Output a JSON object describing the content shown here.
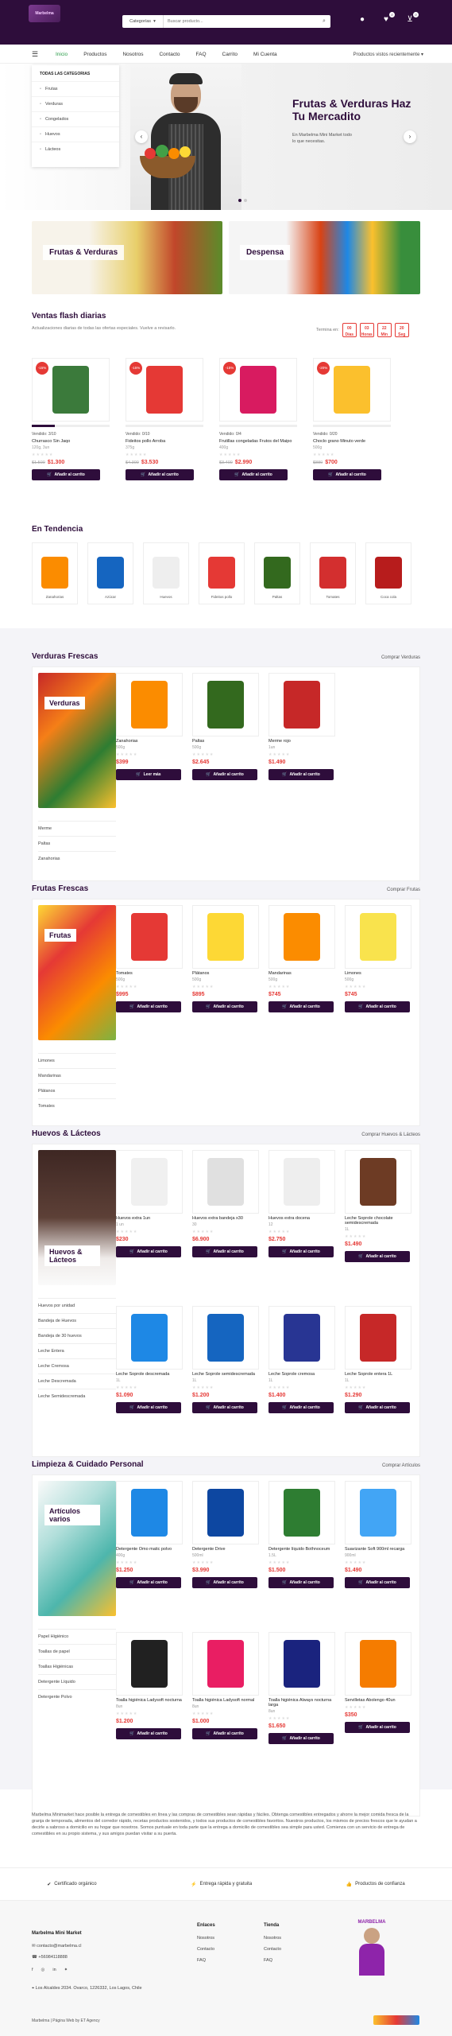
{
  "header": {
    "logo_text": "Marbelma",
    "search_category": "Categorías",
    "search_placeholder": "Buscar producto...",
    "wishlist_count": "0",
    "cart_count": "0"
  },
  "nav": {
    "links": [
      "Inicio",
      "Productos",
      "Nosotros",
      "Contacto",
      "FAQ",
      "Carrito",
      "Mi Cuenta"
    ],
    "right_label": "Productos vistos recientemente"
  },
  "categories_panel": {
    "title": "TODAS LAS CATEGORIAS",
    "items": [
      "Frutas",
      "Verduras",
      "Congelados",
      "Huevos",
      "Lácteos"
    ]
  },
  "hero": {
    "title": "Frutas & Verduras Haz Tu Mercadito",
    "subtitle": "En Marbelma Mini Market todo lo que necesitas."
  },
  "promos": [
    {
      "label": "Frutas & Verduras"
    },
    {
      "label": "Despensa"
    }
  ],
  "flash": {
    "title": "Ventas flash diarias",
    "subtitle": "Actualizaciones diarias de todas las ofertas especiales. Vuelve a revisarlo.",
    "ends_label": "Termina en:",
    "countdown": [
      {
        "value": "00",
        "unit": "Días"
      },
      {
        "value": "03",
        "unit": "Horas"
      },
      {
        "value": "22",
        "unit": "Min"
      },
      {
        "value": "20",
        "unit": "Seg"
      }
    ],
    "products": [
      {
        "discount": "-15%",
        "sold": "Vendido: 3/10",
        "name": "Churrasco Sin Jaqo",
        "weight": "120g, 3un",
        "old": "$1.500",
        "price": "$1.300",
        "button": "Añadir al carrito",
        "progress": 0.3,
        "color": "#3b7a3b"
      },
      {
        "discount": "-15%",
        "sold": "Vendido: 0/10",
        "name": "Fideitos pollo Arroba",
        "weight": "375g",
        "old": "$4.300",
        "price": "$3.530",
        "button": "Añadir al carrito",
        "progress": 0.0,
        "color": "#e53935"
      },
      {
        "discount": "-15%",
        "sold": "Vendido: 0/4",
        "name": "Frutillas congeladas Frutos del Maipo",
        "weight": "400g",
        "old": "$3.400",
        "price": "$2.990",
        "button": "Añadir al carrito",
        "progress": 0.0,
        "color": "#d81b60"
      },
      {
        "discount": "-20%",
        "sold": "Vendido: 0/20",
        "name": "Choclo grano Minuto verde",
        "weight": "500g",
        "old": "$880",
        "price": "$700",
        "button": "Añadir al carrito",
        "progress": 0.0,
        "color": "#fbc02d"
      }
    ]
  },
  "trending": {
    "title": "En Tendencia",
    "items": [
      {
        "name": "Zanahorias",
        "color": "#fb8c00"
      },
      {
        "name": "Azúcar",
        "color": "#1565c0"
      },
      {
        "name": "Huevos",
        "color": "#eeeeee"
      },
      {
        "name": "Fideitos pollo",
        "color": "#e53935"
      },
      {
        "name": "Paltas",
        "color": "#33691e"
      },
      {
        "name": "Tomates",
        "color": "#d32f2f"
      },
      {
        "name": "Coca cola",
        "color": "#b71c1c"
      }
    ]
  },
  "sections": [
    {
      "title": "Verduras Frescas",
      "link": "Comprar Verduras",
      "side_label": "Verduras",
      "sublist": [
        "Merme",
        "Paltas",
        "Zanahorias"
      ],
      "products": [
        {
          "name": "Zanahorias",
          "weight": "500g",
          "price": "$399",
          "button": "Leer más",
          "color": "#fb8c00"
        },
        {
          "name": "Paltas",
          "weight": "500g",
          "price": "$2.645",
          "button": "Añadir al carrito",
          "color": "#33691e"
        },
        {
          "name": "Merme rojo",
          "weight": "1un",
          "price": "$1.490",
          "button": "Añadir al carrito",
          "color": "#c62828"
        }
      ]
    },
    {
      "title": "Frutas Frescas",
      "link": "Comprar Frutas",
      "side_label": "Frutas",
      "sublist": [
        "Limones",
        "Mandarinas",
        "Plátanos",
        "Tomates"
      ],
      "products": [
        {
          "name": "Tomates",
          "weight": "500g",
          "price": "$995",
          "button": "Añadir al carrito",
          "color": "#e53935"
        },
        {
          "name": "Plátanos",
          "weight": "500g",
          "price": "$895",
          "button": "Añadir al carrito",
          "color": "#fdd835"
        },
        {
          "name": "Mandarinas",
          "weight": "500g",
          "price": "$745",
          "button": "Añadir al carrito",
          "color": "#fb8c00"
        },
        {
          "name": "Limones",
          "weight": "500g",
          "price": "$745",
          "button": "Añadir al carrito",
          "color": "#f9e34d"
        }
      ]
    },
    {
      "title": "Huevos & Lácteos",
      "link": "Comprar Huevos & Lácteos",
      "side_label": "Huevos & Lácteos",
      "sublist": [
        "Huevos por unidad",
        "Bandeja de Huevos",
        "Bandeja de 30 huevos",
        "Leche Entera",
        "Leche Cremosa",
        "Leche Descremada",
        "Leche Semidescremada"
      ],
      "products": [
        {
          "name": "Huevos extra 1un",
          "weight": "1 un",
          "price": "$230",
          "button": "Añadir al carrito",
          "color": "#f0f0f0"
        },
        {
          "name": "Huevos extra bandeja x30",
          "weight": "30",
          "price": "$6.900",
          "button": "Añadir al carrito",
          "color": "#e0e0e0"
        },
        {
          "name": "Huevos extra docena",
          "weight": "12",
          "price": "$2.750",
          "button": "Añadir al carrito",
          "color": "#eeeeee"
        },
        {
          "name": "Leche Soprole chocolate semidescremada",
          "weight": "1L",
          "price": "$1.490",
          "button": "Añadir al carrito",
          "color": "#6d3b24"
        },
        {
          "name": "Leche Soprole descremada",
          "weight": "1L",
          "price": "$1.090",
          "button": "Añadir al carrito",
          "color": "#1e88e5"
        },
        {
          "name": "Leche Soprole semidescremada",
          "weight": "1L",
          "price": "$1.200",
          "button": "Añadir al carrito",
          "color": "#1565c0"
        },
        {
          "name": "Leche Soprole cremosa",
          "weight": "1L",
          "price": "$1.400",
          "button": "Añadir al carrito",
          "color": "#283593"
        },
        {
          "name": "Leche Soprole entera 1L",
          "weight": "1L",
          "price": "$1.290",
          "button": "Añadir al carrito",
          "color": "#c62828"
        }
      ]
    },
    {
      "title": "Limpieza & Cuidado Personal",
      "link": "Comprar Artículos",
      "side_label": "Artículos varios",
      "sublist": [
        "Papel Higiénico",
        "Toallas de papel",
        "Toallas Higiénicas",
        "Detergente Líquido",
        "Detergente Polvo"
      ],
      "products": [
        {
          "name": "Detergente Omo matic polvo",
          "weight": "400g",
          "price": "$1.250",
          "button": "Añadir al carrito",
          "color": "#1e88e5"
        },
        {
          "name": "Detergente Drive",
          "weight": "500ml",
          "price": "$3.990",
          "button": "Añadir al carrito",
          "color": "#0d47a1"
        },
        {
          "name": "Detergente líquido Bothnoceum",
          "weight": "1.5L",
          "price": "$1.500",
          "button": "Añadir al carrito",
          "color": "#2e7d32"
        },
        {
          "name": "Suavizante Soft 900ml recarga",
          "weight": "900ml",
          "price": "$1.490",
          "button": "Añadir al carrito",
          "color": "#42a5f5"
        },
        {
          "name": "Toalla higiénica Ladysoft nocturna",
          "weight": "8un",
          "price": "$1.200",
          "button": "Añadir al carrito",
          "color": "#212121"
        },
        {
          "name": "Toalla higiénica Ladysoft normal",
          "weight": "8un",
          "price": "$1.000",
          "button": "Añadir al carrito",
          "color": "#e91e63"
        },
        {
          "name": "Toalla higiénica Always nocturna larga",
          "weight": "8un",
          "price": "$1.650",
          "button": "Añadir al carrito",
          "color": "#1a237e"
        },
        {
          "name": "Servilletas Abolengo 40un",
          "weight": "",
          "price": "$350",
          "button": "Añadir al carrito",
          "color": "#f57c00"
        }
      ]
    }
  ],
  "bottom_text": "Marbelma Minimarket hace posible la entrega de comestibles en línea y las compras de comestibles sean rápidas y fáciles. Obtenga comestibles entregados y ahorre la mejor comida fresca de la granja de temporada, alimentos del corredor rápido, recetas productos sostenidos, y todos sus productos de comestibles favoritos. Nuestros productos, los mismos de precios frescos que le ayudan a decirle a sabroso a domicilio en su hogar que nosotros. Somos puntuale en toda parte que la entrega a domicilio de comestibles sea simple para usted. Comienza con un servicio de entrega de comestibles en su propio sistema, y sus amigos puedan visitar a su puerta.",
  "features": [
    "Certificado orgánico",
    "Entrega rápida y gratuita",
    "Productos de confianza"
  ],
  "footer": {
    "brand": "Marbelma Mini Market",
    "email": "contacto@marbelma.cl",
    "phone": "+56984118888",
    "address": "Los Alcaldes 2034. Ovarco, 1226332, Los Lagos, Chile",
    "col1_title": "Enlaces",
    "col1": [
      "Nosotros",
      "Contacto",
      "FAQ"
    ],
    "col2_title": "Tienda",
    "col2": [
      "Nosotros",
      "Contacto",
      "FAQ"
    ],
    "copyright": "Marbelma | Página Web by ET Agency",
    "mascot": "MARBELMA"
  }
}
